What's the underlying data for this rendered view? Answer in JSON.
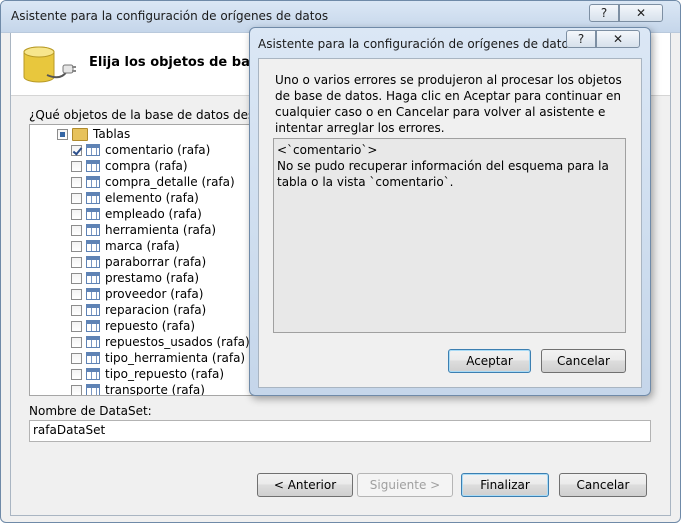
{
  "window": {
    "title": "Asistente para la configuración de orígenes de datos"
  },
  "header": {
    "title": "Elija los objetos de base"
  },
  "question": "¿Qué objetos de la base de datos desea ter",
  "tree": {
    "root_label": "Tablas",
    "items": [
      {
        "label": "comentario (rafa)",
        "checked": true
      },
      {
        "label": "compra (rafa)",
        "checked": false
      },
      {
        "label": "compra_detalle (rafa)",
        "checked": false
      },
      {
        "label": "elemento (rafa)",
        "checked": false
      },
      {
        "label": "empleado (rafa)",
        "checked": false
      },
      {
        "label": "herramienta (rafa)",
        "checked": false
      },
      {
        "label": "marca (rafa)",
        "checked": false
      },
      {
        "label": "paraborrar (rafa)",
        "checked": false
      },
      {
        "label": "prestamo (rafa)",
        "checked": false
      },
      {
        "label": "proveedor (rafa)",
        "checked": false
      },
      {
        "label": "reparacion (rafa)",
        "checked": false
      },
      {
        "label": "repuesto (rafa)",
        "checked": false
      },
      {
        "label": "repuestos_usados (rafa)",
        "checked": false
      },
      {
        "label": "tipo_herramienta (rafa)",
        "checked": false
      },
      {
        "label": "tipo_repuesto (rafa)",
        "checked": false
      },
      {
        "label": "transporte (rafa)",
        "checked": false
      }
    ]
  },
  "dataset": {
    "label": "Nombre de DataSet:",
    "value": "rafaDataSet"
  },
  "buttons": {
    "previous": "< Anterior",
    "next": "Siguiente >",
    "finish": "Finalizar",
    "cancel": "Cancelar"
  },
  "titlebar_buttons": {
    "help": "?",
    "close": "✕"
  },
  "error_dialog": {
    "title": "Asistente para la configuración de orígenes de datos",
    "message": "Uno o varios errores se produjeron al procesar los objetos de base de datos. Haga clic en Aceptar para continuar en cualquier caso o en Cancelar para volver al asistente e intentar arreglar los errores.",
    "detail": "<`comentario`>\nNo se pudo recuperar información del esquema para la tabla o la vista `comentario`.",
    "accept": "Aceptar",
    "cancel": "Cancelar"
  }
}
